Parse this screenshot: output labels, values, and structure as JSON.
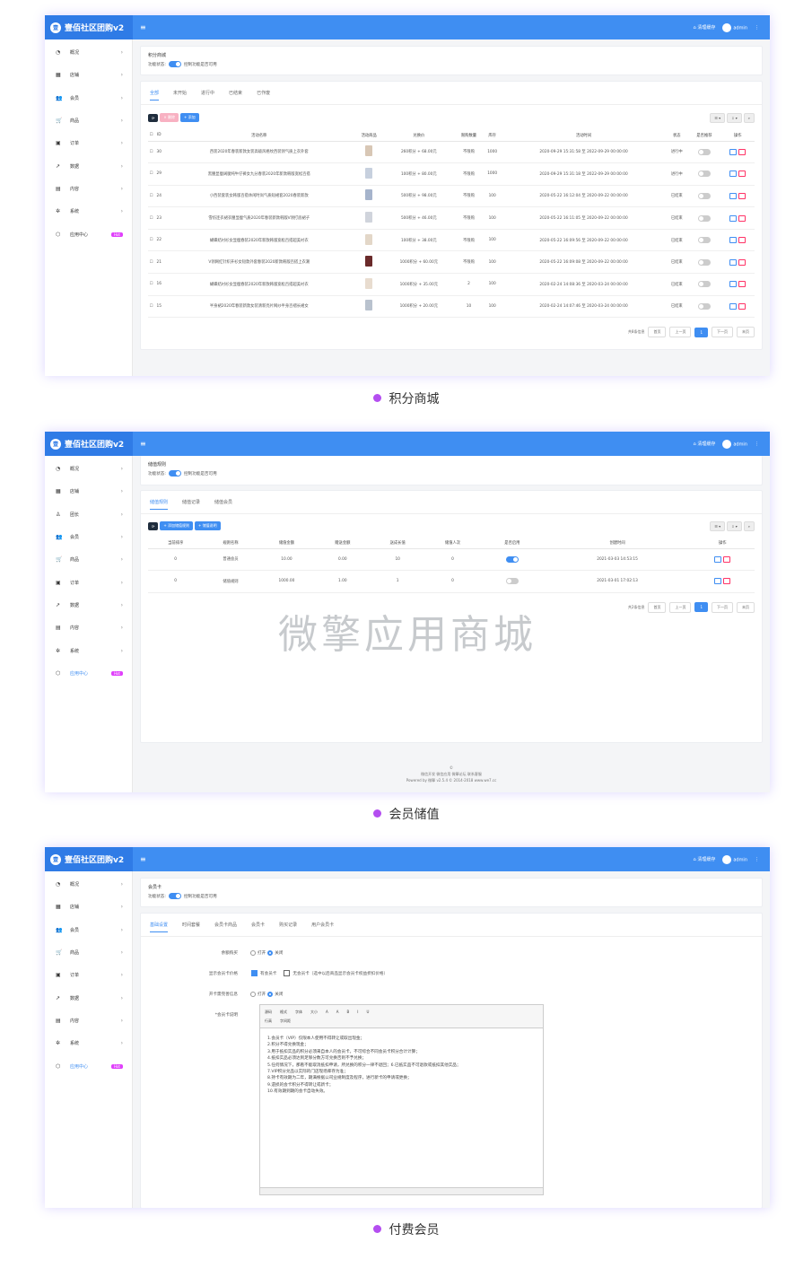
{
  "app": {
    "title": "壹佰社区团购v2",
    "logo": "壹",
    "clear_cache": "清理缓存",
    "user": "admin"
  },
  "sidebar1": [
    {
      "icon": "dashboard-icon",
      "label": "概况"
    },
    {
      "icon": "store-icon",
      "label": "店铺"
    },
    {
      "icon": "users-icon",
      "label": "会员"
    },
    {
      "icon": "cart-icon",
      "label": "商品"
    },
    {
      "icon": "order-icon",
      "label": "订单"
    },
    {
      "icon": "chart-icon",
      "label": "数据"
    },
    {
      "icon": "doc-icon",
      "label": "内容"
    },
    {
      "icon": "gear-icon",
      "label": "系统"
    },
    {
      "icon": "cube-icon",
      "label": "应用中心",
      "badge": "Hot"
    }
  ],
  "sidebar2": [
    {
      "icon": "dashboard-icon",
      "label": "概况"
    },
    {
      "icon": "store-icon",
      "label": "店铺"
    },
    {
      "icon": "leader-icon",
      "label": "团长"
    },
    {
      "icon": "users-icon",
      "label": "会员"
    },
    {
      "icon": "cart-icon",
      "label": "商品"
    },
    {
      "icon": "order-icon",
      "label": "订单"
    },
    {
      "icon": "chart-icon",
      "label": "数据"
    },
    {
      "icon": "doc-icon",
      "label": "内容"
    },
    {
      "icon": "gear-icon",
      "label": "系统"
    },
    {
      "icon": "cube-icon",
      "label": "应用中心",
      "badge": "Hot"
    }
  ],
  "s1": {
    "title": "积分商城",
    "status_label": "功能状态:",
    "status_hint": "控制功能是否可用",
    "tabs": [
      "全部",
      "未开始",
      "进行中",
      "已结束",
      "已作废"
    ],
    "btn_delete": "× 删除",
    "btn_add": "+ 添加",
    "columns": [
      "ID",
      "活动名称",
      "活动商品",
      "兑换价",
      "限购数量",
      "库存",
      "活动时间",
      "状态",
      "是否推荐",
      "操作"
    ],
    "rows": [
      {
        "id": "30",
        "name": "西装2020年春装新款女装高级风格纹西装领气质上衣外套",
        "price": "260积分 + 68.00元",
        "limit": "不限购",
        "stock": "1000",
        "time": "2020-09-29 15:31:58 至 2022-09-29 00:00:00",
        "state": "进行中"
      },
      {
        "id": "29",
        "name": "黑腰显瘦阔腿纯牛仔裤女九分春装2020年新款韩版宽松百搭",
        "price": "100积分 + 80.00元",
        "limit": "不限购",
        "stock": "1000",
        "time": "2020-09-29 15:31:18 至 2022-09-29 00:00:00",
        "state": "进行中"
      },
      {
        "id": "24",
        "name": "小西装套装女韩版百搭休闲时尚气质短裙套2020春装新款",
        "price": "500积分 + 98.00元",
        "limit": "不限购",
        "stock": "100",
        "time": "2020-05-22 16:12:04 至 2020-09-22 00:00:00",
        "state": "已结束"
      },
      {
        "id": "23",
        "name": "雪纺连衣裙衣腰显瘦气质2020年春装新款韩版V领打底裙子",
        "price": "500积分 + 46.00元",
        "limit": "不限购",
        "stock": "100",
        "time": "2020-05-22 16:11:05 至 2020-09-22 00:00:00",
        "state": "已结束"
      },
      {
        "id": "22",
        "name": "蝴蝶结衬衫女显瘦春装2020年新款韩版宽松百搭超美衬衣",
        "price": "100积分 + 38.00元",
        "limit": "不限购",
        "stock": "100",
        "time": "2020-05-22 16:09:56 至 2020-09-22 00:00:00",
        "state": "已结束"
      },
      {
        "id": "21",
        "name": "V领网红针织开衫女短款外套春装2020新款韩版百搭上衣潮",
        "price": "1000积分 + 60.00元",
        "limit": "不限购",
        "stock": "100",
        "time": "2020-05-22 16:09:08 至 2020-09-22 00:00:00",
        "state": "已结束"
      },
      {
        "id": "16",
        "name": "蝴蝶结衬衫女显瘦春装2020年新款韩版宽松百搭超美衬衣",
        "price": "1000积分 + 35.00元",
        "limit": "2",
        "stock": "100",
        "time": "2020-02-24 14:08:36 至 2020-03-24 00:00:00",
        "state": "已结束"
      },
      {
        "id": "15",
        "name": "半身裙2020年春装新款女装清新亮片网纱半身百褶长裙女",
        "price": "1000积分 + 20.00元",
        "limit": "10",
        "stock": "100",
        "time": "2020-02-24 14:07:46 至 2020-03-24 00:00:00",
        "state": "已结束"
      }
    ],
    "pager": {
      "total": "共8条信息",
      "first": "首页",
      "prev": "上一页",
      "cur": "1",
      "next": "下一页",
      "last": "末页"
    },
    "caption": "积分商城"
  },
  "s2": {
    "title": "储值规则",
    "status_label": "功能状态:",
    "status_hint": "控制功能是否可用",
    "tabs": [
      "储值规则",
      "储值记录",
      "储值会员"
    ],
    "btn_add": "+ 添加储值规则",
    "btn_desc": "+ 储值说明",
    "columns": [
      "当前排序",
      "规则名称",
      "储值金额",
      "赠送金额",
      "送成长值",
      "储值人次",
      "是否启用",
      "创建时间",
      "操作"
    ],
    "rows": [
      {
        "sort": "0",
        "name": "普通会员",
        "amount": "10.00",
        "gift": "0.00",
        "growth": "10",
        "count": "0",
        "enabled": true,
        "time": "2021-03-03 14:53:15"
      },
      {
        "sort": "0",
        "name": "储值规则",
        "amount": "1000.00",
        "gift": "1.00",
        "growth": "1",
        "count": "0",
        "enabled": false,
        "time": "2021-03-01 17:02:13"
      }
    ],
    "pager": {
      "total": "共2条信息",
      "first": "首页",
      "prev": "上一页",
      "cur": "1",
      "next": "下一页",
      "last": "末页"
    },
    "watermark": "微擎应用商城",
    "footer": [
      "微信开发 微信应用 微擎论坛 联系客服",
      "Powered by 微擎 v2.5.4 © 2014-2018 www.we7.cc"
    ],
    "caption": "会员储值"
  },
  "s3": {
    "title": "会员卡",
    "status_label": "功能状态:",
    "status_hint": "控制功能是否可用",
    "tabs": [
      "基础设置",
      "时间套餐",
      "会员卡商品",
      "会员卡",
      "购买记录",
      "用户会员卡"
    ],
    "f1_label": "余额购买",
    "f2_label": "显示会员卡价格",
    "f3_label": "开卡需完善信息",
    "f4_label": "*会员卡说明",
    "opt_open": "打开",
    "opt_close": "关闭",
    "opt_member": "有会员卡",
    "opt_nomember": "无会员卡（选中以后商品显示会员卡权益折扣价格）",
    "editor_tools": [
      "源码",
      "格式",
      "字体",
      "大小",
      "A",
      "A",
      "B",
      "I",
      "U",
      "行高",
      "字间距"
    ],
    "editor_lines": [
      "1.会员卡（VIP）仅限本人使用不得转让或取出现金；",
      "2.积分不得兑换现金；",
      "3.用于抵扣实品的积分必须来自本人的会员卡，不可综合不同会员卡积分合计计算；",
      "4.抵扣实品必须达到足够分数方可兑换否则不予兑换；",
      "5.任何情况下，那看不能取消抵扣申请，所兑换的积分一律不退回；6.已抵实品不可退款或抵扣其他实品；",
      "7.VIP积分兑品以实际的门店现场库存为准；",
      "8.持卡有效期为二年，期满根据公司业规制度及程序，进行新卡的申请或更换；",
      "9.遗损的会卡积分不得转让或新卡；",
      "10.有效期到期的会卡自动失效。"
    ],
    "caption": "付费会员"
  }
}
